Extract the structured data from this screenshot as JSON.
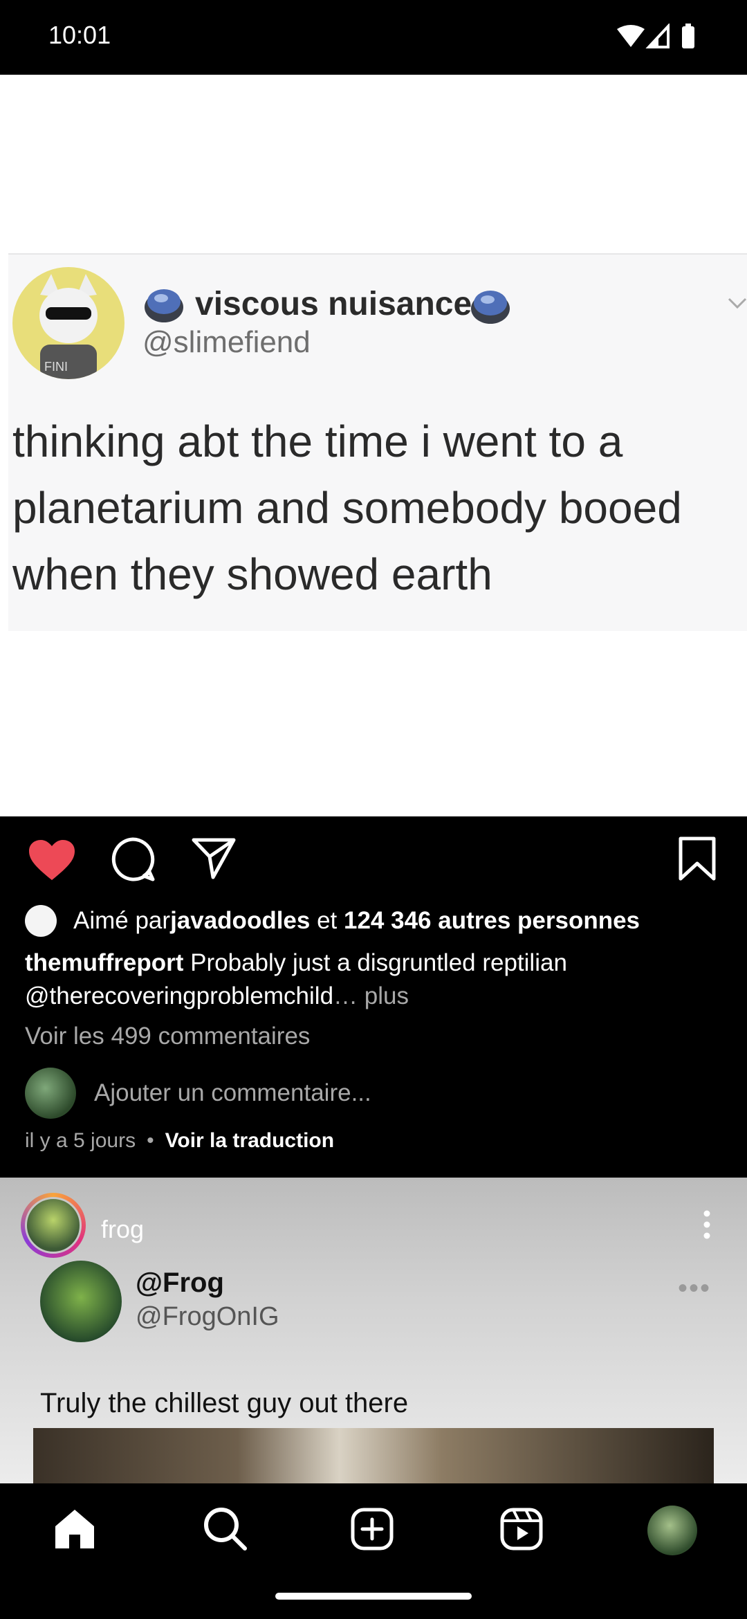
{
  "status_bar": {
    "time": "10:01"
  },
  "post1": {
    "tweet": {
      "name": "viscous nuisance",
      "handle": "@slimefiend",
      "text": "thinking abt the time i went to a planetarium and somebody booed when they showed earth",
      "avatar_text": "FINI"
    },
    "likes": {
      "prefix": "Aimé par ",
      "user": "javadoodles",
      "middle": " et ",
      "count": "124 346 autres personnes"
    },
    "caption": {
      "username": "themuffreport",
      "text": " Probably just a disgruntled reptilian",
      "mention": "@therecoveringproblemchild",
      "more": "… plus"
    },
    "comments_link": "Voir les 499 commentaires",
    "comment_placeholder": "Ajouter un commentaire...",
    "time_ago": "il y a 5 jours",
    "separator": "•",
    "translate": "Voir la traduction"
  },
  "post2": {
    "username": "frog",
    "tweet": {
      "name": "@Frog",
      "handle": "@FrogOnIG",
      "dots": "•••",
      "text": "Truly the chillest guy out there"
    }
  },
  "colors": {
    "like_red": "#ed4956",
    "background": "#000000",
    "muted_text": "#a8a8a8"
  },
  "icons": [
    "wifi-icon",
    "signal-icon",
    "battery-icon",
    "heart-icon",
    "comment-icon",
    "share-icon",
    "bookmark-icon",
    "more-icon",
    "home-icon",
    "search-icon",
    "create-icon",
    "reels-icon"
  ]
}
